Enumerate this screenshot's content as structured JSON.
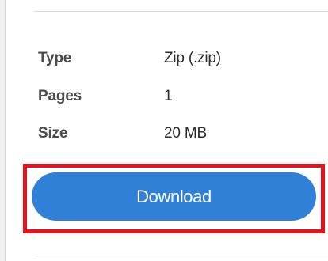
{
  "file_info": {
    "rows": [
      {
        "label": "Type",
        "value": "Zip (.zip)"
      },
      {
        "label": "Pages",
        "value": "1"
      },
      {
        "label": "Size",
        "value": "20 MB"
      }
    ]
  },
  "actions": {
    "download_label": "Download"
  },
  "colors": {
    "button": "#2f80d6",
    "highlight": "#e3141d"
  }
}
